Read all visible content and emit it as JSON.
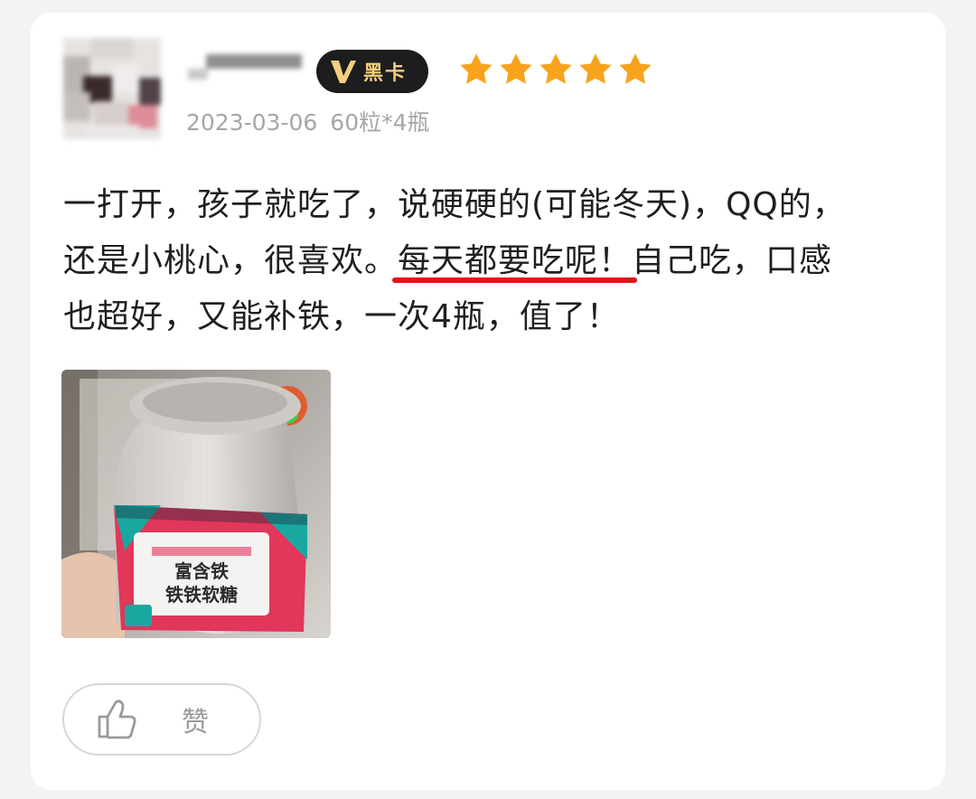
{
  "review": {
    "badge": {
      "label": "黑卡",
      "icon": "v-vip-icon"
    },
    "rating": {
      "stars": 5,
      "max": 5,
      "color": "#f7a31c"
    },
    "date": "2023-03-06",
    "variant": "60粒*4瓶",
    "text": {
      "line1": "一打开，孩子就吃了，说硬硬的(可能冬天)，QQ的，",
      "line2_a": "还是小桃心，很喜欢。",
      "line2_highlight": "每天都要吃呢！",
      "line2_b": "自己吃，口感",
      "line3": "也超好，又能补铁，一次4瓶，值了！"
    },
    "photo": {
      "jar_label": {
        "line1": "富含铁",
        "line2": "铁铁软糖"
      }
    },
    "like": {
      "label": "赞",
      "icon": "thumbs-up-icon"
    }
  },
  "colors": {
    "highlight_underline": "#e3121a",
    "badge_bg": "#1d1d1f",
    "badge_text": "#f3cf7c"
  }
}
